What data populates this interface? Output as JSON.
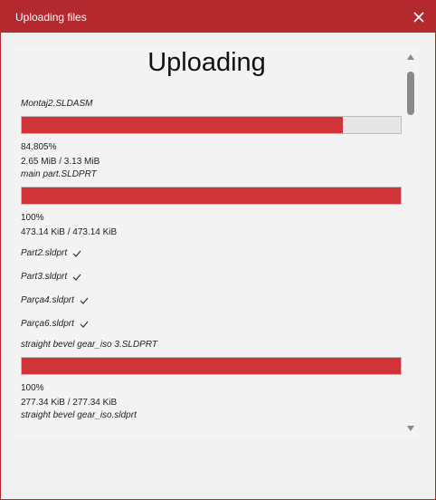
{
  "window": {
    "title": "Uploading files"
  },
  "heading": "Uploading",
  "uploads": [
    {
      "name": "Montaj2.SLDASM",
      "progress": 0.84805,
      "percent": "84.805%",
      "size": "2.65 MiB / 3.13 MiB"
    },
    {
      "name": "main part.SLDPRT",
      "progress": 1.0,
      "percent": "100%",
      "size": "473.14 KiB / 473.14 KiB"
    }
  ],
  "completed": [
    "Part2.sldprt",
    "Part3.sldprt",
    "Parça4.sldprt",
    "Parça6.sldprt"
  ],
  "upload3": {
    "name": "straight bevel gear_iso 3.SLDPRT",
    "progress": 1.0,
    "percent": "100%",
    "size": "277.34 KiB / 277.34 KiB"
  },
  "next_file": "straight bevel gear_iso.sldprt",
  "icons": {
    "close": "close-icon",
    "check": "check-icon",
    "scroll_up": "chevron-up-icon",
    "scroll_down": "chevron-down-icon"
  },
  "colors": {
    "accent": "#b4292e",
    "progress_fill": "#d13438"
  }
}
